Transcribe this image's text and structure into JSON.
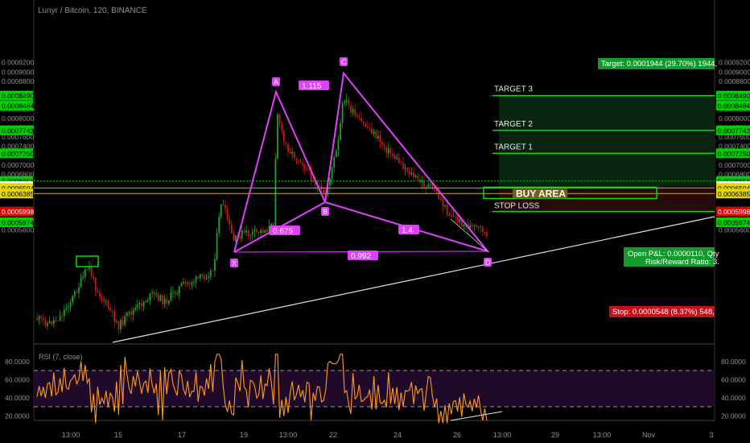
{
  "title": "Lunyr / Bitcoin, 120, BINANCE",
  "rsi_label": "RSI (7, close)",
  "colors": {
    "bg": "#000000",
    "pattern": "#e040fb",
    "target": "#00e000",
    "stop": "#ff1a1a",
    "candle_up": "#1fa02f",
    "candle_down": "#c41a1a",
    "rsi_line": "#ff9a1f",
    "buy_area": "#c8b400",
    "trend": "#e0e0e0"
  },
  "price_axis": {
    "ticks": [
      "0.0009200",
      "0.0009000",
      "0.0008800",
      "0.0008200",
      "0.0008000",
      "0.0007800",
      "0.0007600",
      "0.0007400",
      "0.0007000",
      "0.0006800",
      "0.0005800",
      "0.0005600"
    ]
  },
  "price_badges": [
    {
      "label": "0.0008490",
      "kind": "green"
    },
    {
      "label": "0.0008484",
      "kind": "green"
    },
    {
      "label": "0.0007743",
      "kind": "green"
    },
    {
      "label": "0.0007250",
      "kind": "green"
    },
    {
      "label": "0.0006656",
      "kind": "green"
    },
    {
      "label": "01:31:15",
      "kind": "green"
    },
    {
      "label": "0.0006546",
      "kind": "white"
    },
    {
      "label": "0.0006504",
      "kind": "yellow"
    },
    {
      "label": "0.0006385",
      "kind": "yellow"
    },
    {
      "label": "0.0005998",
      "kind": "red"
    },
    {
      "label": "0.0005974",
      "kind": "green"
    }
  ],
  "right_ticks": [
    "0.0009200",
    "0.0009000",
    "0.0008800",
    "0.0008200",
    "0.0008000",
    "0.0007800",
    "0.0007600",
    "0.0007400",
    "0.0007000",
    "0.0006800",
    "0.0005800",
    "0.0005600"
  ],
  "time_axis": [
    "13:00",
    "15",
    "17",
    "19",
    "13:00",
    "22",
    "24",
    "26",
    "13:00",
    "29",
    "13:00",
    "Nov",
    "3"
  ],
  "rsi_axis": [
    "80.0000",
    "60.0000",
    "40.0000",
    "20.0000"
  ],
  "rsi_axis_right": [
    "80.0000",
    "60.0000",
    "40.0000",
    "20.0000"
  ],
  "pattern": {
    "points": [
      {
        "label": "X",
        "price": 0.000653
      },
      {
        "label": "A",
        "price": 0.00083
      },
      {
        "label": "B",
        "price": 0.000711
      },
      {
        "label": "C",
        "price": 0.000852
      },
      {
        "label": "D",
        "price": 0.000654
      }
    ],
    "ratios": [
      "1.115",
      "0.675",
      "1.4",
      "0.992"
    ]
  },
  "trade": {
    "targets": [
      "TARGET 3",
      "TARGET 2",
      "TARGET 1"
    ],
    "stop": "STOP LOSS",
    "buy_area": "BUY AREA",
    "target_info": "Target: 0.0001944 (29.70%) 1944,",
    "stop_info": "Stop: 0.0000548 (8.37%) 548,",
    "pnl_line1": "Open P&L: 0.0000110, Qty",
    "pnl_line2": "Risk/Reward Ratio: 3."
  },
  "chart_data": {
    "type": "candlestick",
    "symbol": "Lunyr / Bitcoin",
    "timeframe": "120",
    "exchange": "BINANCE",
    "x_ticks": [
      "13:00",
      "15",
      "17",
      "19",
      "13:00",
      "22",
      "24",
      "26",
      "13:00",
      "29",
      "13:00",
      "Nov",
      "3"
    ],
    "price_ylim": [
      0.00056,
      0.00092
    ],
    "price_approx_path": [
      {
        "x": "start",
        "price": 0.00061
      },
      {
        "x": "13:00",
        "price": 0.000615
      },
      {
        "x": "~14",
        "price": 0.00065
      },
      {
        "x": "15",
        "price": 0.000585
      },
      {
        "x": "17",
        "price": 0.000625
      },
      {
        "x": "18",
        "price": 0.0007
      },
      {
        "x": "19",
        "price": 0.000655
      },
      {
        "x": "13:00",
        "price": 0.00083
      },
      {
        "x": "22",
        "price": 0.000711
      },
      {
        "x": "22",
        "price": 0.000852
      },
      {
        "x": "24",
        "price": 0.000745
      },
      {
        "x": "26",
        "price": 0.00066
      }
    ],
    "harmonic_pattern": {
      "points": [
        "X",
        "A",
        "B",
        "C",
        "D"
      ],
      "ratios": [
        1.115,
        0.675,
        1.4,
        0.992
      ]
    },
    "levels": [
      {
        "name": "TARGET 3",
        "price": 0.000849
      },
      {
        "name": "TARGET 2",
        "price": 0.0007743
      },
      {
        "name": "TARGET 1",
        "price": 0.000725
      },
      {
        "name": "entry",
        "price": 0.0006546
      },
      {
        "name": "STOP LOSS",
        "price": 0.0005998
      }
    ],
    "rsi": {
      "label": "RSI (7, close)",
      "ylim": [
        10,
        90
      ],
      "bands": [
        70,
        30
      ],
      "ticks": [
        80,
        60,
        40,
        20
      ]
    }
  }
}
